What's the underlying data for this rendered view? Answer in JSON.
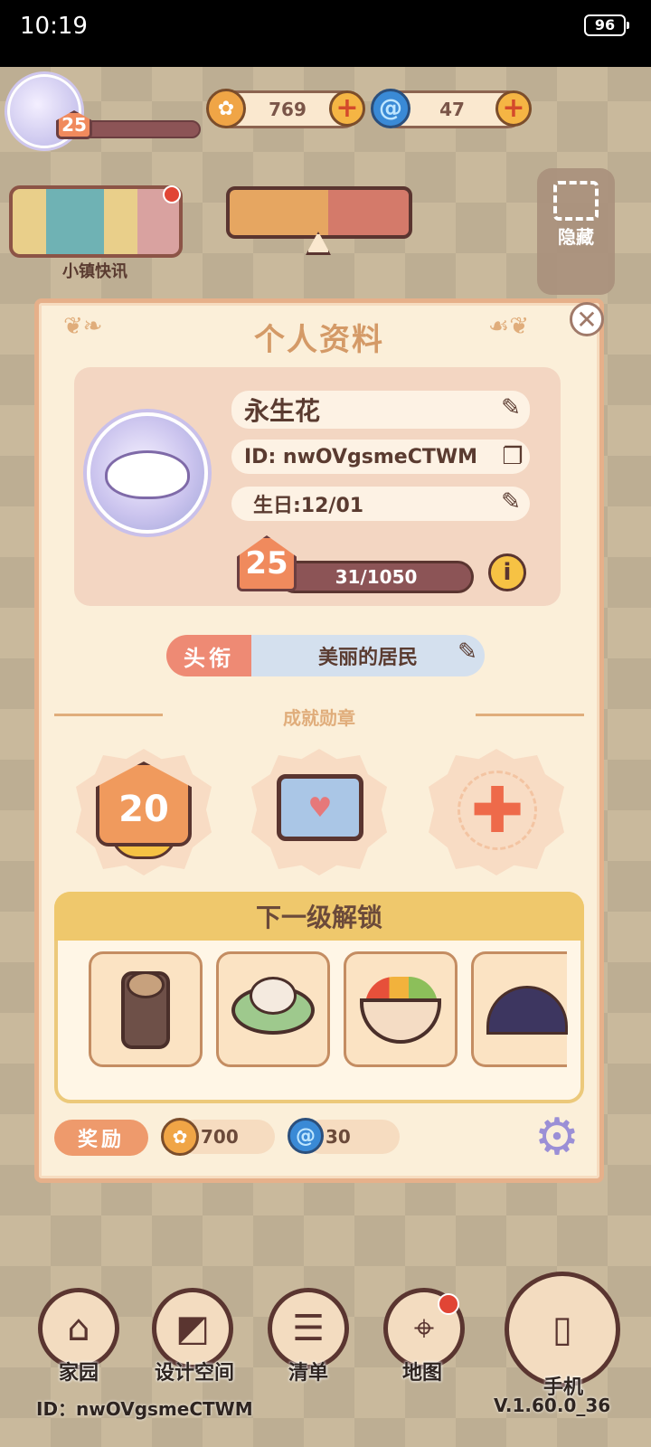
{
  "status_bar": {
    "time": "10:19",
    "battery": "96"
  },
  "hud": {
    "player_level": "25",
    "gold": "769",
    "gems": "47",
    "plus_symbol": "+",
    "town_news_label": "小镇快讯",
    "hide_label": "隐藏"
  },
  "profile": {
    "title": "个人资料",
    "name": "永生花",
    "id": "ID: nwOVgsmeCTWM",
    "birthday": "生日:12/01",
    "level": "25",
    "xp": "31/1050",
    "honor_tag": "头衔",
    "honor_value": "美丽的居民",
    "achievements_label": "成就勋章",
    "medal_level": "20",
    "next_unlock_label": "下一级解锁",
    "reward_label": "奖励",
    "reward_gold": "700",
    "reward_gems": "30"
  },
  "nav": {
    "home": "家园",
    "design": "设计空间",
    "list": "清单",
    "map": "地图",
    "phone": "手机"
  },
  "footer": {
    "id": "ID：nwOVgsmeCTWM",
    "version": "V.1.60.0_36"
  },
  "colors": {
    "card_bg": "#fbefd9",
    "title_color": "#d49a67",
    "level_orange": "#f08a5d",
    "xp_bar": "#8c5456"
  }
}
